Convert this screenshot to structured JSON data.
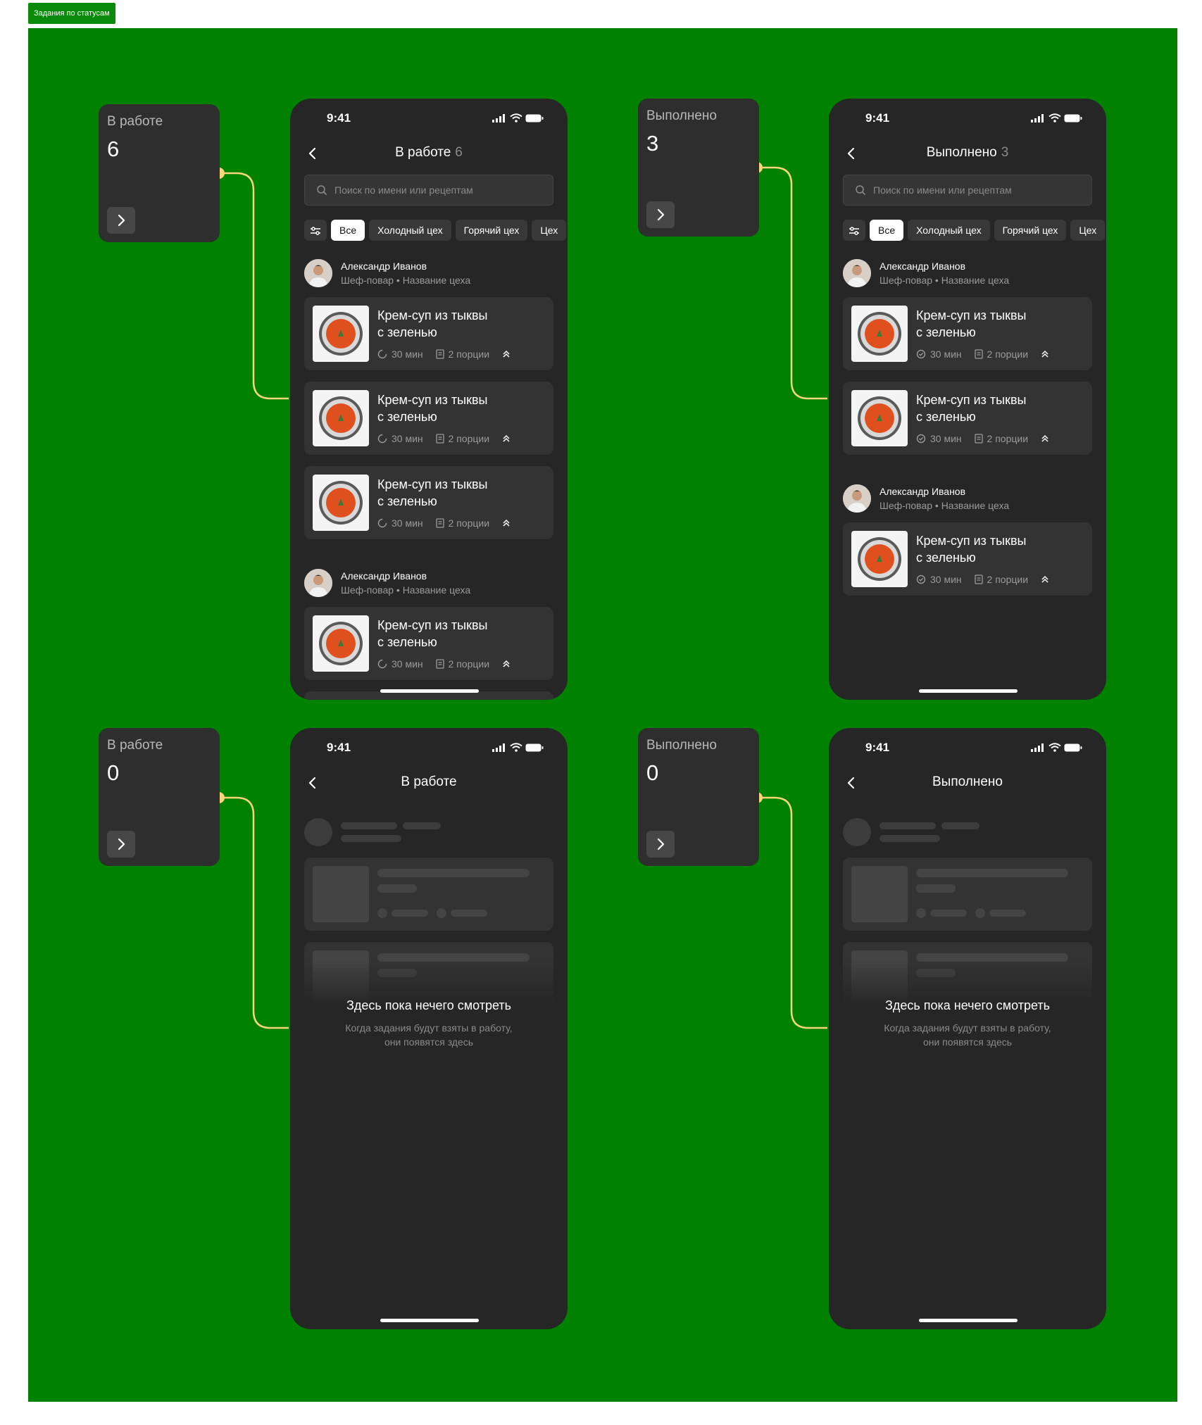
{
  "frame_label": "Задания по статусам",
  "status_bar": {
    "time": "9:41"
  },
  "cards": [
    {
      "title": "В работе",
      "count": "6"
    },
    {
      "title": "Выполнено",
      "count": "3"
    },
    {
      "title": "В работе",
      "count": "0"
    },
    {
      "title": "Выполнено",
      "count": "0"
    }
  ],
  "screens": {
    "in_progress": {
      "title": "В работе",
      "count": "6"
    },
    "done": {
      "title": "Выполнено",
      "count": "3"
    },
    "in_progress_empty": {
      "title": "В работе"
    },
    "done_empty": {
      "title": "Выполнено"
    }
  },
  "search": {
    "placeholder": "Поиск по имени или рецептам"
  },
  "chips": [
    "Все",
    "Холодный цех",
    "Горячий цех",
    "Цех"
  ],
  "person": {
    "name": "Александр Иванов",
    "role": "Шеф-повар • Название цеха"
  },
  "task": {
    "title_line1": "Крем-суп из тыквы",
    "title_line2": "с зеленью",
    "time": "30 мин",
    "portions": "2 порции"
  },
  "empty": {
    "title": "Здесь пока нечего смотреть",
    "subtitle_line1": "Когда задания будут взяты в работу,",
    "subtitle_line2": "они появятся здесь"
  },
  "colors": {
    "canvas": "#008200",
    "phone": "#262626",
    "card": "#2e2e2e",
    "wire": "#f6d679"
  }
}
